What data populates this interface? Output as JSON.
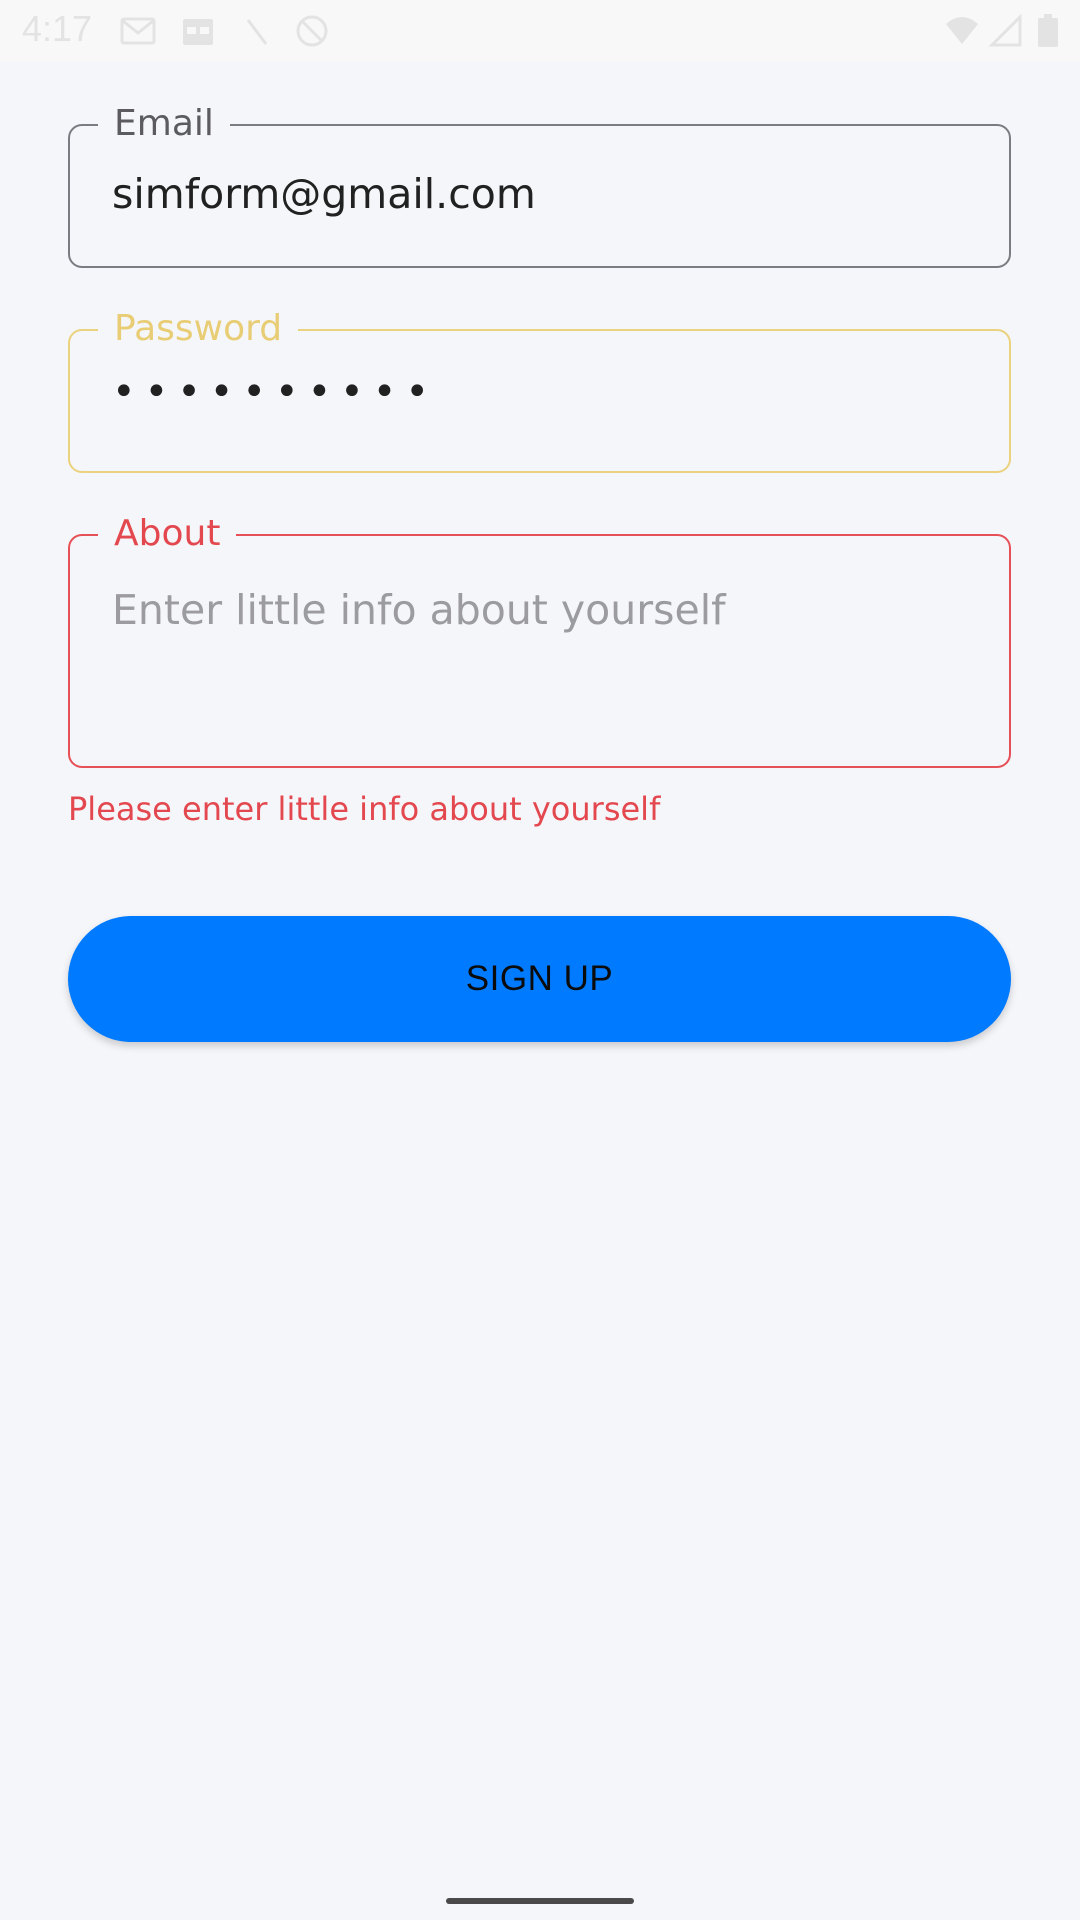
{
  "status_bar": {
    "time": "4:17",
    "icons": [
      "gmail-icon",
      "calendar-icon",
      "signal-slash-icon",
      "do-not-disturb-icon",
      "wifi-icon",
      "cellular-icon",
      "battery-icon"
    ]
  },
  "form": {
    "email": {
      "label": "Email",
      "value": "simform@gmail.com"
    },
    "password": {
      "label": "Password",
      "value": "••••••••••"
    },
    "about": {
      "label": "About",
      "placeholder": "Enter little info about yourself",
      "error": "Please enter little info about yourself"
    },
    "signup_label": "SIGN UP"
  },
  "colors": {
    "background": "#f5f6fa",
    "email_border": "#7b7c82",
    "password_accent": "#ead27f",
    "error": "#e4484f",
    "button": "#007aff"
  }
}
